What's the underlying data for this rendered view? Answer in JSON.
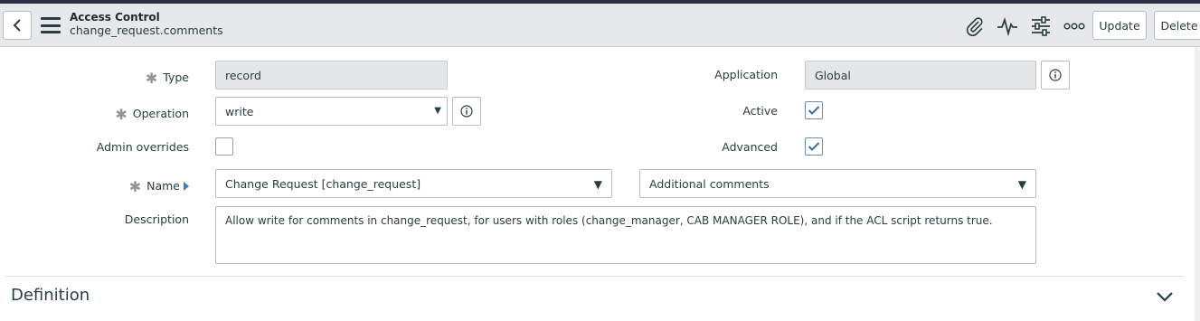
{
  "header": {
    "title": "Access Control",
    "subtitle": "change_request.comments",
    "update_label": "Update",
    "delete_label": "Delete"
  },
  "form": {
    "type": {
      "label": "Type",
      "value": "record"
    },
    "operation": {
      "label": "Operation",
      "value": "write"
    },
    "admin_overrides": {
      "label": "Admin overrides",
      "checked": false
    },
    "name": {
      "label": "Name",
      "table_value": "Change Request [change_request]",
      "field_value": "Additional comments"
    },
    "description": {
      "label": "Description",
      "value": "Allow write for comments in change_request, for users with roles (change_manager, CAB MANAGER ROLE), and if the ACL script returns true."
    },
    "application": {
      "label": "Application",
      "value": "Global"
    },
    "active": {
      "label": "Active",
      "checked": true
    },
    "advanced": {
      "label": "Advanced",
      "checked": true
    }
  },
  "section": {
    "title": "Definition"
  },
  "colors": {
    "header_bg": "#e6e8ea",
    "top_strip": "#2e2f45",
    "check": "#3a6fa0",
    "caret": "#3a7cc8"
  }
}
